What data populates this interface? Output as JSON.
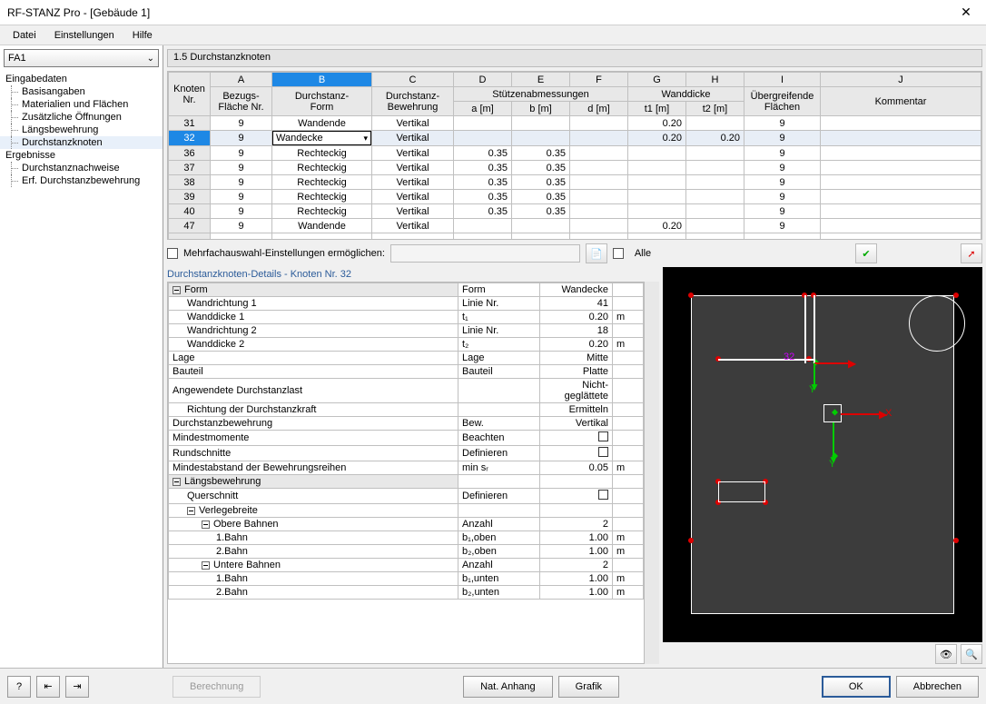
{
  "window": {
    "title": "RF-STANZ Pro  - [Gebäude 1]"
  },
  "menu": {
    "datei": "Datei",
    "einstellungen": "Einstellungen",
    "hilfe": "Hilfe"
  },
  "fa_dropdown": {
    "value": "FA1"
  },
  "tree": {
    "eingabedaten": "Eingabedaten",
    "basisangaben": "Basisangaben",
    "materialien": "Materialien und Flächen",
    "zusatz": "Zusätzliche Öffnungen",
    "laengs": "Längsbewehrung",
    "durchstanz": "Durchstanzknoten",
    "ergebnisse": "Ergebnisse",
    "nachweise": "Durchstanznachweise",
    "erfbew": "Erf. Durchstanzbewehrung"
  },
  "panel": {
    "title": "1.5 Durchstanzknoten"
  },
  "grid": {
    "col_letters": [
      "A",
      "B",
      "C",
      "D",
      "E",
      "F",
      "G",
      "H",
      "I",
      "J"
    ],
    "headers": {
      "knoten_nr": "Knoten\nNr.",
      "bezug": "Bezugs-\nFläche Nr.",
      "dform": "Durchstanz-\nForm",
      "dbew": "Durchstanz-\nBewehrung",
      "stuetz": "Stützenabmessungen",
      "a_m": "a [m]",
      "b_m": "b [m]",
      "d_m": "d [m]",
      "wand": "Wanddicke",
      "t1": "t1 [m]",
      "t2": "t2 [m]",
      "uebergreif": "Übergreifende\nFlächen",
      "kommentar": "Kommentar"
    },
    "rows": [
      {
        "nr": "31",
        "bez": "9",
        "form": "Wandende",
        "bew": "Vertikal",
        "a": "",
        "b": "",
        "d": "",
        "t1": "0.20",
        "t2": "",
        "fl": "9"
      },
      {
        "nr": "32",
        "bez": "9",
        "form": "Wandecke",
        "bew": "Vertikal",
        "a": "",
        "b": "",
        "d": "",
        "t1": "0.20",
        "t2": "0.20",
        "fl": "9",
        "selected": true
      },
      {
        "nr": "36",
        "bez": "9",
        "form": "Rechteckig",
        "bew": "Vertikal",
        "a": "0.35",
        "b": "0.35",
        "d": "",
        "t1": "",
        "t2": "",
        "fl": "9"
      },
      {
        "nr": "37",
        "bez": "9",
        "form": "Rechteckig",
        "bew": "Vertikal",
        "a": "0.35",
        "b": "0.35",
        "d": "",
        "t1": "",
        "t2": "",
        "fl": "9"
      },
      {
        "nr": "38",
        "bez": "9",
        "form": "Rechteckig",
        "bew": "Vertikal",
        "a": "0.35",
        "b": "0.35",
        "d": "",
        "t1": "",
        "t2": "",
        "fl": "9"
      },
      {
        "nr": "39",
        "bez": "9",
        "form": "Rechteckig",
        "bew": "Vertikal",
        "a": "0.35",
        "b": "0.35",
        "d": "",
        "t1": "",
        "t2": "",
        "fl": "9"
      },
      {
        "nr": "40",
        "bez": "9",
        "form": "Rechteckig",
        "bew": "Vertikal",
        "a": "0.35",
        "b": "0.35",
        "d": "",
        "t1": "",
        "t2": "",
        "fl": "9"
      },
      {
        "nr": "47",
        "bez": "9",
        "form": "Wandende",
        "bew": "Vertikal",
        "a": "",
        "b": "",
        "d": "",
        "t1": "0.20",
        "t2": "",
        "fl": "9"
      }
    ]
  },
  "filter": {
    "label": "Mehrfachauswahl-Einstellungen ermöglichen:",
    "alle": "Alle"
  },
  "details": {
    "title": "Durchstanzknoten-Details - Knoten Nr.  32",
    "rows": [
      {
        "l": "Form",
        "m": "Form",
        "v": "Wandecke",
        "u": "",
        "ind": 0,
        "exp": true,
        "hdr": true
      },
      {
        "l": "Wandrichtung 1",
        "m": "Linie Nr.",
        "v": "41",
        "u": "",
        "ind": 1
      },
      {
        "l": "Wanddicke 1",
        "m": "t₁",
        "v": "0.20",
        "u": "m",
        "ind": 1
      },
      {
        "l": "Wandrichtung 2",
        "m": "Linie Nr.",
        "v": "18",
        "u": "",
        "ind": 1
      },
      {
        "l": "Wanddicke 2",
        "m": "t₂",
        "v": "0.20",
        "u": "m",
        "ind": 1
      },
      {
        "l": "Lage",
        "m": "Lage",
        "v": "Mitte",
        "u": "",
        "ind": 0
      },
      {
        "l": "Bauteil",
        "m": "Bauteil",
        "v": "Platte",
        "u": "",
        "ind": 0
      },
      {
        "l": "Angewendete Durchstanzlast",
        "m": "",
        "v": "Nicht-geglättete",
        "u": "",
        "ind": 0
      },
      {
        "l": "Richtung der Durchstanzkraft",
        "m": "",
        "v": "Ermitteln",
        "u": "",
        "ind": 1
      },
      {
        "l": "Durchstanzbewehrung",
        "m": "Bew.",
        "v": "Vertikal",
        "u": "",
        "ind": 0
      },
      {
        "l": "Mindestmomente",
        "m": "Beachten",
        "v": "☐",
        "u": "",
        "ind": 0,
        "chk": true
      },
      {
        "l": "Rundschnitte",
        "m": "Definieren",
        "v": "☐",
        "u": "",
        "ind": 0,
        "chk": true
      },
      {
        "l": "Mindestabstand der Bewehrungsreihen",
        "m": "min sᵣ",
        "v": "0.05",
        "u": "m",
        "ind": 0
      },
      {
        "l": "Längsbewehrung",
        "m": "",
        "v": "",
        "u": "",
        "ind": 0,
        "exp": true,
        "hdr": true
      },
      {
        "l": "Querschnitt",
        "m": "Definieren",
        "v": "☐",
        "u": "",
        "ind": 1,
        "chk": true
      },
      {
        "l": "Verlegebreite",
        "m": "",
        "v": "",
        "u": "",
        "ind": 1,
        "exp": true
      },
      {
        "l": "Obere Bahnen",
        "m": "Anzahl",
        "v": "2",
        "u": "",
        "ind": 2,
        "exp": true
      },
      {
        "l": "1.Bahn",
        "m": "b₁,oben",
        "v": "1.00",
        "u": "m",
        "ind": 3
      },
      {
        "l": "2.Bahn",
        "m": "b₂,oben",
        "v": "1.00",
        "u": "m",
        "ind": 3
      },
      {
        "l": "Untere Bahnen",
        "m": "Anzahl",
        "v": "2",
        "u": "",
        "ind": 2,
        "exp": true
      },
      {
        "l": "1.Bahn",
        "m": "b₁,unten",
        "v": "1.00",
        "u": "m",
        "ind": 3
      },
      {
        "l": "2.Bahn",
        "m": "b₂,unten",
        "v": "1.00",
        "u": "m",
        "ind": 3
      }
    ],
    "axis": {
      "x": "X",
      "y": "Y",
      "y2": "Y"
    },
    "node_label": "32"
  },
  "buttons": {
    "berechnung": "Berechnung",
    "natanhang": "Nat. Anhang",
    "grafik": "Grafik",
    "ok": "OK",
    "abbrechen": "Abbrechen"
  }
}
